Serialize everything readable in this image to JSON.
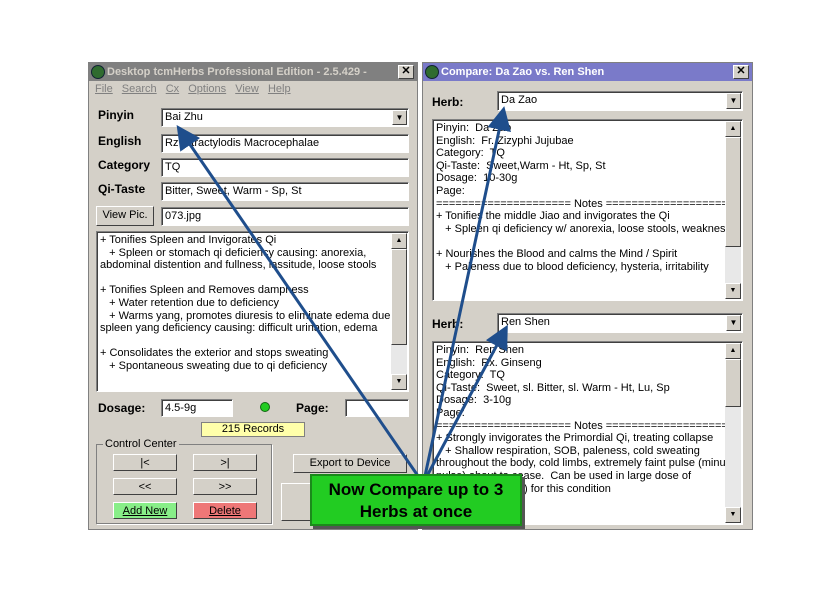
{
  "main_window": {
    "title": "Desktop tcmHerbs Professional Edition - 2.5.429 -",
    "menu": [
      "File",
      "Search",
      "Cx",
      "Options",
      "View",
      "Help"
    ],
    "pinyin_label": "Pinyin",
    "pinyin_value": "Bai Zhu",
    "english_label": "English",
    "english_value": "Rz. Atractylodis Macrocephalae",
    "category_label": "Category",
    "category_value": "TQ",
    "qitaste_label": "Qi-Taste",
    "qitaste_value": "Bitter, Sweet, Warm - Sp, St",
    "viewpic_label": "View Pic.",
    "pic_value": "073.jpg",
    "notes": [
      "+ Tonifies Spleen and Invigorates Qi",
      "   + Spleen or stomach qi deficiency causing: anorexia,",
      "abdominal distention and fullness, lassitude, loose stools",
      "",
      "+ Tonifies Spleen and Removes dampness",
      "   + Water retention due to deficiency",
      "   + Warms yang, promotes diuresis to eliminate edema due to",
      "spleen yang deficiency causing: difficult urination, edema",
      "",
      "+ Consolidates the exterior and stops sweating",
      "   + Spontaneous sweating due to qi deficiency"
    ],
    "dosage_label": "Dosage:",
    "dosage_value": "4.5-9g",
    "page_label": "Page:",
    "page_value": "",
    "records": "215 Records",
    "control_center_label": "Control Center",
    "btn_first": "|<",
    "btn_last": ">|",
    "btn_prev": "<<",
    "btn_next": ">>",
    "btn_add": "Add New",
    "btn_delete": "Delete",
    "btn_export": "Export to Device"
  },
  "compare_window": {
    "title": "Compare:  Da Zao vs. Ren Shen",
    "herb_label_1": "Herb:",
    "herb1_value": "Da Zao",
    "herb1_text": [
      "Pinyin:  Da Zao",
      "English:  Fr. Zizyphi Jujubae",
      "Category:  TQ",
      "Qi-Taste:  Sweet,Warm - Ht, Sp, St",
      "Dosage:  10-30g",
      "Page:",
      "===================== Notes =====================",
      "+ Tonifies the middle Jiao and invigorates the Qi",
      "   + Spleen qi deficiency w/ anorexia, loose stools, weakness",
      "",
      "+ Nourishes the Blood and calms the Mind / Spirit",
      "   + Paleness due to blood deficiency, hysteria, irritability"
    ],
    "herb_label_2": "Herb:",
    "herb2_value": "Ren Shen",
    "herb2_text": [
      "Pinyin:  Ren Shen",
      "English:  Rx. Ginseng",
      "Category:  TQ",
      "Qi-Taste:  Sweet, sl. Bitter, sl. Warm - Ht, Lu, Sp",
      "Dosage:  3-10g",
      "Page:",
      "===================== Notes =====================",
      "+ Strongly invigorates the Primordial Qi, treating collapse",
      "   + Shallow respiration, SOB, paleness, cold sweating",
      "throughout the body, cold limbs, extremely faint pulse (minute",
      "pulse) about to cease.  Can be used in large dose of",
      "decoction (15-30g) for this condition"
    ]
  },
  "callout": {
    "line1": "Now Compare up to 3",
    "line2": "Herbs at once"
  },
  "colors": {
    "active_title": "#7a7ac9",
    "inactive_title": "#808080",
    "callout_green": "#22cc22",
    "arrow_blue": "#1f4e8c",
    "add_btn": "#88ee88",
    "delete_btn": "#ee7777",
    "records_bg": "#ffffaa"
  }
}
